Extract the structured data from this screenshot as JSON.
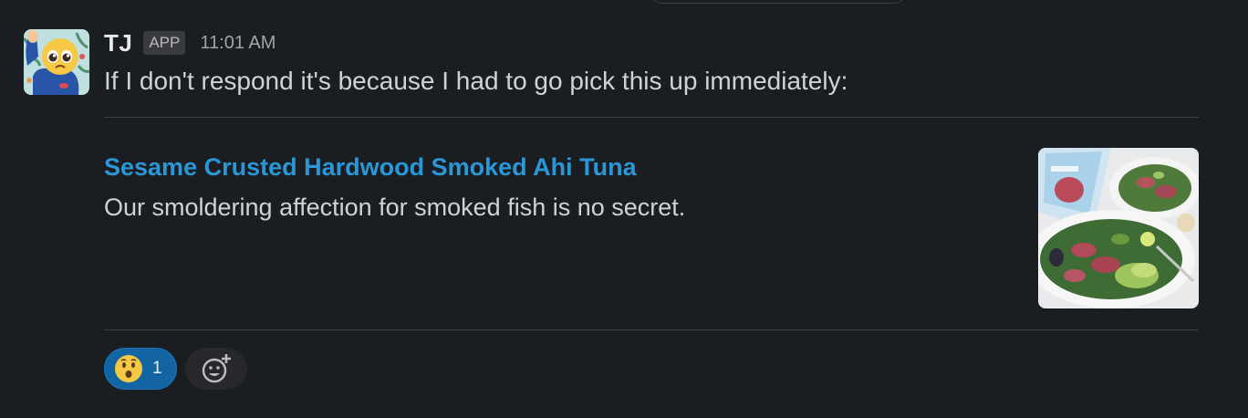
{
  "message": {
    "sender": "TJ",
    "badge": "APP",
    "timestamp": "11:01 AM",
    "text": "If I don't respond it's because I had to go pick this up immediately:",
    "avatar_icon": "pleading-face-raised-hand-icon"
  },
  "unfurl": {
    "title": "Sesame Crusted Hardwood Smoked Ahi Tuna",
    "description": "Our smoldering affection for smoked fish is no secret.",
    "thumbnail_icon": "tuna-salad-photo"
  },
  "reactions": [
    {
      "emoji_icon": "hushed-face-icon",
      "count": "1",
      "active": true
    }
  ],
  "add_reaction_icon": "add-emoji-icon",
  "colors": {
    "background": "#1a1d21",
    "link": "#2a97d6",
    "reaction_active": "#1264a3"
  }
}
